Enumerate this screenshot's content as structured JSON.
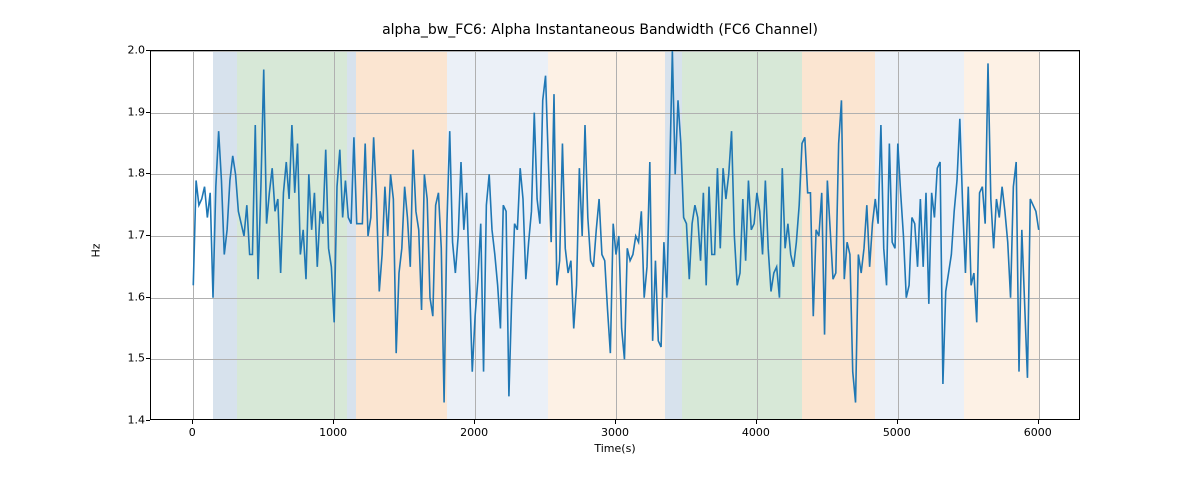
{
  "chart_data": {
    "type": "line",
    "title": "alpha_bw_FC6: Alpha Instantaneous Bandwidth (FC6 Channel)",
    "xlabel": "Time(s)",
    "ylabel": "Hz",
    "xlim": [
      -300,
      6300
    ],
    "ylim": [
      1.4,
      2.0
    ],
    "xticks": [
      0,
      1000,
      2000,
      3000,
      4000,
      5000,
      6000
    ],
    "yticks": [
      1.4,
      1.5,
      1.6,
      1.7,
      1.8,
      1.9,
      2.0
    ],
    "background_regions": [
      {
        "x0": 140,
        "x1": 310,
        "color": "#6e98bd"
      },
      {
        "x0": 310,
        "x1": 1090,
        "color": "#6ead6e"
      },
      {
        "x0": 1090,
        "x1": 1155,
        "color": "#6e98bd"
      },
      {
        "x0": 1155,
        "x1": 1800,
        "color": "#f2a05a"
      },
      {
        "x0": 1800,
        "x1": 2520,
        "color": "#b7c9e2"
      },
      {
        "x0": 2520,
        "x1": 3350,
        "color": "#f7cda0"
      },
      {
        "x0": 3350,
        "x1": 3470,
        "color": "#6e98bd"
      },
      {
        "x0": 3470,
        "x1": 4320,
        "color": "#6ead6e"
      },
      {
        "x0": 4320,
        "x1": 4840,
        "color": "#f2a05a"
      },
      {
        "x0": 4840,
        "x1": 5470,
        "color": "#b7c9e2"
      },
      {
        "x0": 5470,
        "x1": 6000,
        "color": "#f7cda0"
      }
    ],
    "x": [
      0,
      20,
      40,
      60,
      80,
      100,
      120,
      140,
      160,
      180,
      200,
      220,
      240,
      260,
      280,
      300,
      320,
      340,
      360,
      380,
      400,
      420,
      440,
      460,
      480,
      500,
      520,
      540,
      560,
      580,
      600,
      620,
      640,
      660,
      680,
      700,
      720,
      740,
      760,
      780,
      800,
      820,
      840,
      860,
      880,
      900,
      920,
      940,
      960,
      980,
      1000,
      1020,
      1040,
      1060,
      1080,
      1100,
      1120,
      1140,
      1160,
      1180,
      1200,
      1220,
      1240,
      1260,
      1280,
      1300,
      1320,
      1340,
      1360,
      1380,
      1400,
      1420,
      1440,
      1460,
      1480,
      1500,
      1520,
      1540,
      1560,
      1580,
      1600,
      1620,
      1640,
      1660,
      1680,
      1700,
      1720,
      1740,
      1760,
      1780,
      1800,
      1820,
      1840,
      1860,
      1880,
      1900,
      1920,
      1940,
      1960,
      1980,
      2000,
      2020,
      2040,
      2060,
      2080,
      2100,
      2120,
      2140,
      2160,
      2180,
      2200,
      2220,
      2240,
      2260,
      2280,
      2300,
      2320,
      2340,
      2360,
      2380,
      2400,
      2420,
      2440,
      2460,
      2480,
      2500,
      2520,
      2540,
      2560,
      2580,
      2600,
      2620,
      2640,
      2660,
      2680,
      2700,
      2720,
      2740,
      2760,
      2780,
      2800,
      2820,
      2840,
      2860,
      2880,
      2900,
      2920,
      2940,
      2960,
      2980,
      3000,
      3020,
      3040,
      3060,
      3080,
      3100,
      3120,
      3140,
      3160,
      3180,
      3200,
      3220,
      3240,
      3260,
      3280,
      3300,
      3320,
      3340,
      3360,
      3380,
      3400,
      3420,
      3440,
      3460,
      3480,
      3500,
      3520,
      3540,
      3560,
      3580,
      3600,
      3620,
      3640,
      3660,
      3680,
      3700,
      3720,
      3740,
      3760,
      3780,
      3800,
      3820,
      3840,
      3860,
      3880,
      3900,
      3920,
      3940,
      3960,
      3980,
      4000,
      4020,
      4040,
      4060,
      4080,
      4100,
      4120,
      4140,
      4160,
      4180,
      4200,
      4220,
      4240,
      4260,
      4280,
      4300,
      4320,
      4340,
      4360,
      4380,
      4400,
      4420,
      4440,
      4460,
      4480,
      4500,
      4520,
      4540,
      4560,
      4580,
      4600,
      4620,
      4640,
      4660,
      4680,
      4700,
      4720,
      4740,
      4760,
      4780,
      4800,
      4820,
      4840,
      4860,
      4880,
      4900,
      4920,
      4940,
      4960,
      4980,
      5000,
      5020,
      5040,
      5060,
      5080,
      5100,
      5120,
      5140,
      5160,
      5180,
      5200,
      5220,
      5240,
      5260,
      5280,
      5300,
      5320,
      5340,
      5360,
      5380,
      5400,
      5420,
      5440,
      5460,
      5480,
      5500,
      5520,
      5540,
      5560,
      5580,
      5600,
      5620,
      5640,
      5660,
      5680,
      5700,
      5720,
      5740,
      5760,
      5780,
      5800,
      5820,
      5840,
      5860,
      5880,
      5900,
      5920,
      5940,
      5960,
      5980,
      6000
    ],
    "y": [
      1.62,
      1.79,
      1.75,
      1.76,
      1.78,
      1.73,
      1.77,
      1.6,
      1.78,
      1.87,
      1.79,
      1.67,
      1.71,
      1.79,
      1.83,
      1.8,
      1.74,
      1.72,
      1.7,
      1.75,
      1.67,
      1.67,
      1.88,
      1.63,
      1.78,
      1.97,
      1.72,
      1.77,
      1.81,
      1.74,
      1.76,
      1.64,
      1.77,
      1.82,
      1.76,
      1.88,
      1.77,
      1.85,
      1.67,
      1.71,
      1.63,
      1.8,
      1.71,
      1.77,
      1.65,
      1.74,
      1.72,
      1.84,
      1.68,
      1.65,
      1.56,
      1.78,
      1.84,
      1.73,
      1.79,
      1.73,
      1.72,
      1.86,
      1.72,
      1.72,
      1.72,
      1.85,
      1.7,
      1.73,
      1.86,
      1.76,
      1.61,
      1.67,
      1.78,
      1.7,
      1.8,
      1.76,
      1.51,
      1.64,
      1.68,
      1.78,
      1.73,
      1.65,
      1.84,
      1.74,
      1.71,
      1.58,
      1.8,
      1.76,
      1.6,
      1.57,
      1.75,
      1.77,
      1.68,
      1.43,
      1.72,
      1.87,
      1.69,
      1.64,
      1.7,
      1.82,
      1.71,
      1.77,
      1.63,
      1.48,
      1.57,
      1.63,
      1.72,
      1.48,
      1.75,
      1.8,
      1.71,
      1.67,
      1.62,
      1.55,
      1.75,
      1.74,
      1.44,
      1.6,
      1.72,
      1.71,
      1.81,
      1.76,
      1.63,
      1.69,
      1.74,
      1.9,
      1.76,
      1.72,
      1.92,
      1.96,
      1.82,
      1.69,
      1.93,
      1.62,
      1.66,
      1.85,
      1.68,
      1.64,
      1.66,
      1.55,
      1.62,
      1.81,
      1.7,
      1.88,
      1.73,
      1.66,
      1.65,
      1.71,
      1.76,
      1.67,
      1.66,
      1.58,
      1.51,
      1.72,
      1.67,
      1.7,
      1.55,
      1.5,
      1.68,
      1.66,
      1.67,
      1.7,
      1.69,
      1.74,
      1.6,
      1.65,
      1.82,
      1.53,
      1.66,
      1.53,
      1.52,
      1.69,
      1.6,
      1.79,
      2.0,
      1.8,
      1.92,
      1.85,
      1.73,
      1.72,
      1.63,
      1.72,
      1.75,
      1.73,
      1.66,
      1.77,
      1.62,
      1.78,
      1.67,
      1.67,
      1.81,
      1.68,
      1.81,
      1.76,
      1.8,
      1.87,
      1.7,
      1.62,
      1.64,
      1.76,
      1.66,
      1.79,
      1.71,
      1.72,
      1.77,
      1.74,
      1.67,
      1.79,
      1.68,
      1.61,
      1.64,
      1.65,
      1.6,
      1.81,
      1.68,
      1.72,
      1.67,
      1.65,
      1.69,
      1.75,
      1.85,
      1.86,
      1.77,
      1.77,
      1.57,
      1.71,
      1.7,
      1.77,
      1.54,
      1.79,
      1.71,
      1.63,
      1.64,
      1.85,
      1.92,
      1.63,
      1.69,
      1.67,
      1.48,
      1.43,
      1.67,
      1.64,
      1.68,
      1.75,
      1.65,
      1.72,
      1.76,
      1.72,
      1.88,
      1.68,
      1.62,
      1.85,
      1.69,
      1.68,
      1.85,
      1.77,
      1.7,
      1.6,
      1.62,
      1.73,
      1.72,
      1.65,
      1.76,
      1.65,
      1.77,
      1.59,
      1.77,
      1.73,
      1.81,
      1.82,
      1.46,
      1.61,
      1.64,
      1.67,
      1.74,
      1.79,
      1.89,
      1.75,
      1.64,
      1.78,
      1.62,
      1.64,
      1.56,
      1.77,
      1.78,
      1.72,
      1.98,
      1.76,
      1.68,
      1.76,
      1.73,
      1.78,
      1.74,
      1.69,
      1.6,
      1.78,
      1.82,
      1.48,
      1.71,
      1.59,
      1.47,
      1.76,
      1.75,
      1.74,
      1.71
    ]
  }
}
